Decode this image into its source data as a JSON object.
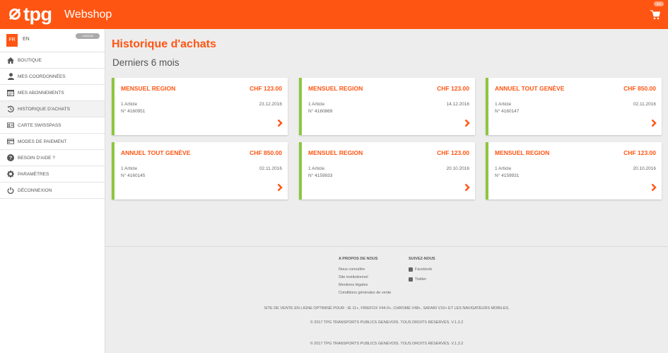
{
  "header": {
    "logo_text": "tpg",
    "app_title": "Webshop",
    "cart_badge": "0%"
  },
  "sidebar": {
    "lang_active": "FR",
    "lang_other": "EN",
    "lang_badge": "LANGUE",
    "items": [
      {
        "label": "BOUTIQUE",
        "icon": "home-icon"
      },
      {
        "label": "MES COORDONNÉES",
        "icon": "user-icon"
      },
      {
        "label": "MES ABONNEMENTS",
        "icon": "calendar-icon"
      },
      {
        "label": "HISTORIQUE D'ACHATS",
        "icon": "history-icon"
      },
      {
        "label": "CARTE SWISSPASS",
        "icon": "id-card-icon"
      },
      {
        "label": "MODES DE PAIEMENT",
        "icon": "credit-card-icon"
      },
      {
        "label": "BESOIN D'AIDE ?",
        "icon": "help-icon"
      },
      {
        "label": "PARAMÈTRES",
        "icon": "gear-icon"
      },
      {
        "label": "DÉCONNEXION",
        "icon": "power-icon"
      }
    ]
  },
  "main": {
    "page_title": "Historique d'achats",
    "section_title": "Derniers 6 mois",
    "orders": [
      {
        "name": "MENSUEL REGION",
        "price": "CHF 123.00",
        "count": "1 Article",
        "date": "23.12.2016",
        "number": "N° 4160951"
      },
      {
        "name": "MENSUEL REGION",
        "price": "CHF 123.00",
        "count": "1 Article",
        "date": "14.12.2016",
        "number": "N° 4160869"
      },
      {
        "name": "ANNUEL TOUT GENÈVE",
        "price": "CHF 850.00",
        "count": "1 Article",
        "date": "02.11.2016",
        "number": "N° 4160147"
      },
      {
        "name": "ANNUEL TOUT GENÈVE",
        "price": "CHF 850.00",
        "count": "1 Article",
        "date": "02.11.2016",
        "number": "N° 4160145"
      },
      {
        "name": "MENSUEL REGION",
        "price": "CHF 123.00",
        "count": "1 Article",
        "date": "20.10.2016",
        "number": "N° 4159933"
      },
      {
        "name": "MENSUEL REGION",
        "price": "CHF 123.00",
        "count": "1 Article",
        "date": "20.10.2016",
        "number": "N° 4159931"
      }
    ]
  },
  "footer": {
    "about_title": "A PROPOS DE NOUS",
    "about_links": [
      "Nous connaître",
      "Site institutionnel",
      "Mentions légales",
      "Conditions générales de vente"
    ],
    "follow_title": "SUIVEZ-NOUS",
    "follow_links": [
      "Facebook",
      "Twitter"
    ],
    "browser_note": "SITE DE VENTE EN LIGNE OPTIMISÉ POUR : IE 11+, FIREFOX V44.0+, CHROME V48+, SAFARI V10+ ET LES NAVIGATEURS MOBILES.",
    "copyright_1": "© 2017 TPG TRANSPORTS PUBLICS GENEVOIS. TOUS DROITS RÉSERVÉS.  V.1.3.2",
    "copyright_2": "© 2017 TPG TRANSPORTS PUBLICS GENEVOIS. TOUS DROITS RÉSERVÉS.  V.1.3.2"
  },
  "colors": {
    "brand_orange": "#ff5512",
    "accent_green": "#8dc63f",
    "background": "#ededed"
  }
}
